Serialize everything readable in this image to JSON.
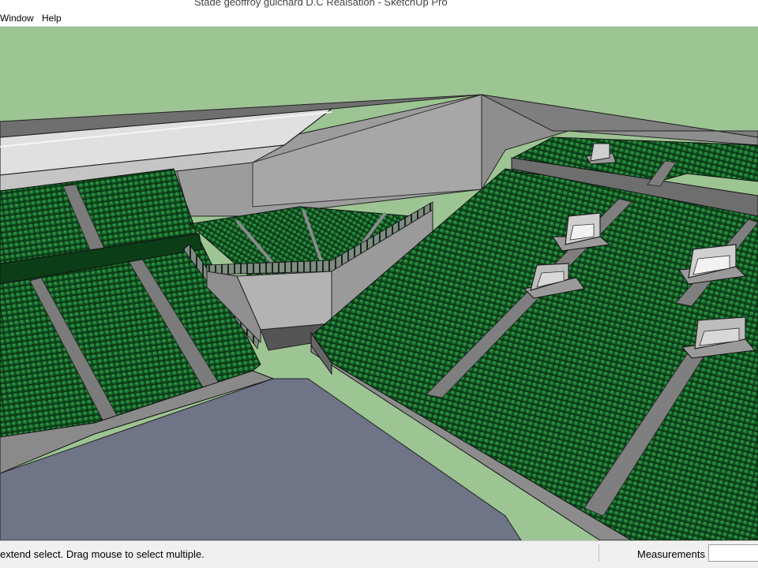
{
  "window": {
    "title": "Stade geoffroy guichard D.C Realsation - SketchUp Pro"
  },
  "menu": {
    "items": [
      {
        "id": "window",
        "label": "Window"
      },
      {
        "id": "help",
        "label": "Help"
      }
    ]
  },
  "viewport": {
    "scene": "stadium-3d-model",
    "colors": {
      "sky": "#9dc493",
      "seat_green": "#1f7a34",
      "seat_dark": "#0b3d17",
      "concrete": "#8c8c8c",
      "wall": "#a9a9a9",
      "pitch": "#6f7487",
      "roof": "#d4d4d4",
      "edge": "#1a1a1a"
    }
  },
  "status": {
    "hint": "extend select. Drag mouse to select multiple.",
    "measurements_label": "Measurements",
    "measurements_value": ""
  }
}
